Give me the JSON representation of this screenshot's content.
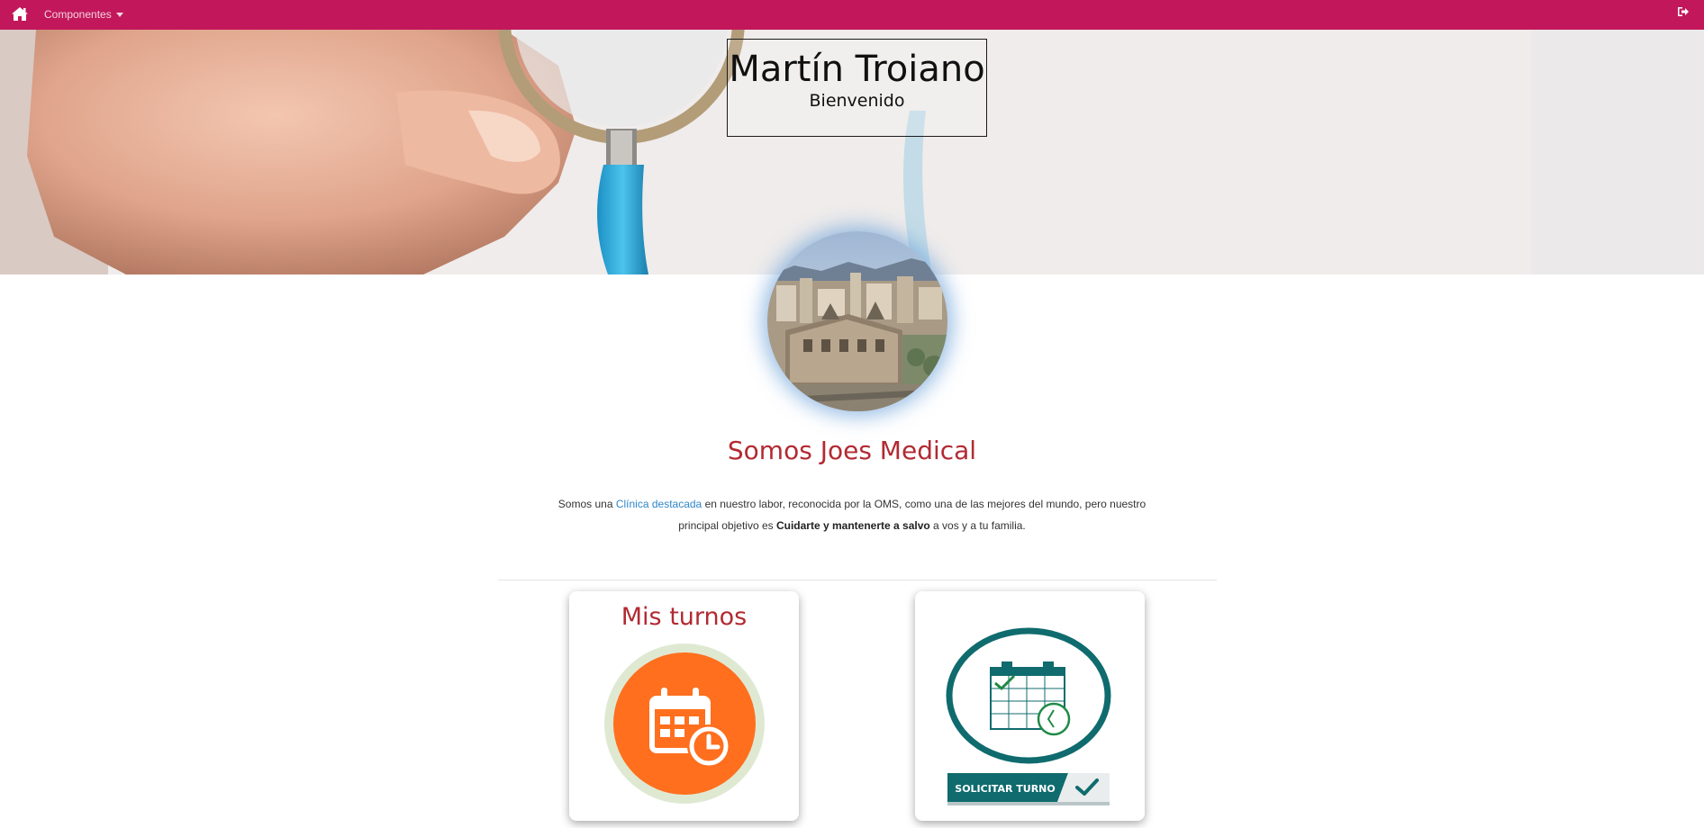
{
  "colors": {
    "navbar": "#c2185b",
    "accent_red": "#b22a32",
    "link_blue": "#2f86c8",
    "turnos_orange": "#ff6f1e",
    "solicitar_teal": "#0f6b6e"
  },
  "navbar": {
    "home_icon": "home-icon",
    "menu_label": "Componentes",
    "logout_icon": "sign-out-icon"
  },
  "hero": {
    "name": "Martín Troiano",
    "subtitle": "Bienvenido"
  },
  "about": {
    "title": "Somos Joes Medical",
    "text_pre": "Somos una ",
    "text_link": "Clínica destacada",
    "text_mid": " en nuestro labor, reconocida por la OMS, como una de las mejores del mundo, pero nuestro principal objetivo es ",
    "text_bold": "Cuidarte y mantenerte a salvo",
    "text_post": " a vos y a tu familia."
  },
  "cards": {
    "turnos": {
      "title": "Mis turnos",
      "icon": "calendar-clock-icon"
    },
    "solicitar": {
      "label": "SOLICITAR TURNO",
      "icon": "calendar-check-icon"
    }
  }
}
